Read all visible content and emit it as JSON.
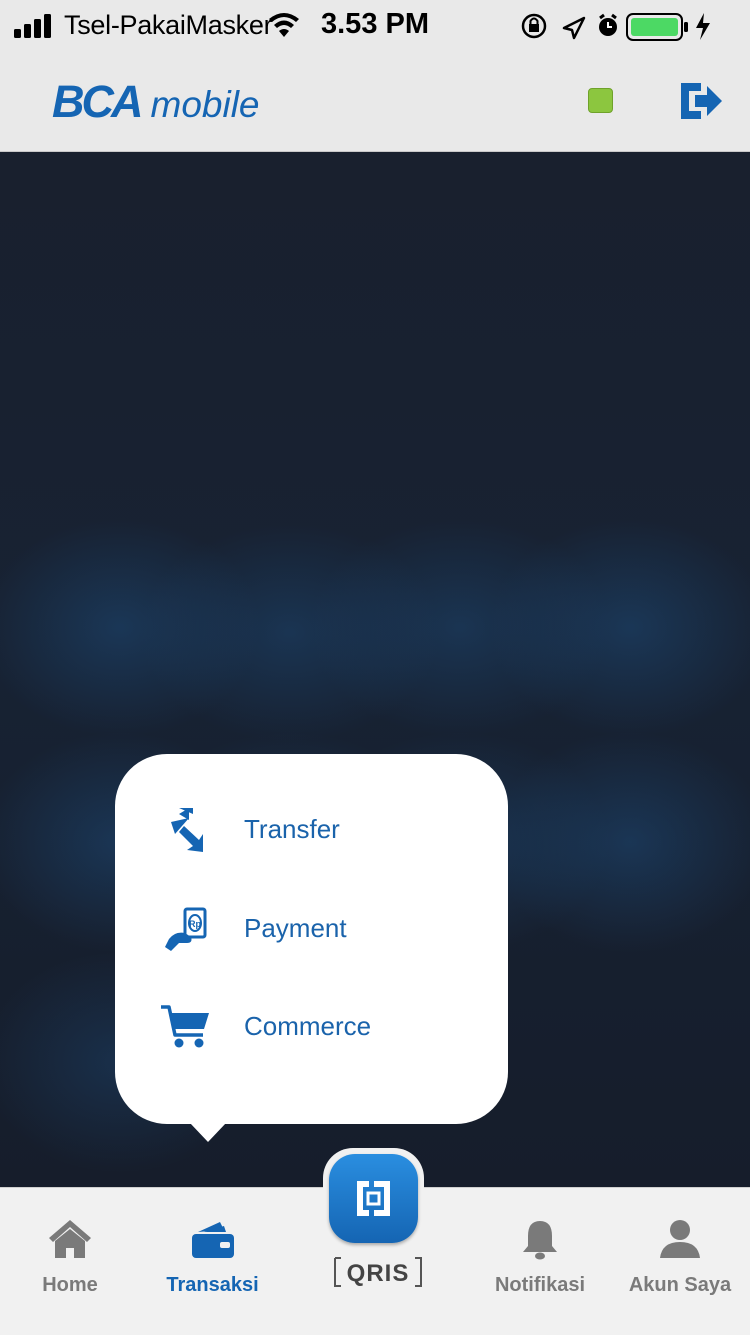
{
  "status_bar": {
    "carrier": "Tsel-PakaiMasker",
    "time": "3.53 PM",
    "icons": [
      "signal-icon",
      "wifi-icon",
      "rotation-lock-icon",
      "location-icon",
      "alarm-icon",
      "battery-icon",
      "charging-icon"
    ],
    "battery_color": "#4cd964"
  },
  "header": {
    "logo_bca": "BCA",
    "logo_mobile": "mobile",
    "status_indicator_color": "#8cc63f",
    "logout_icon": "logout-icon",
    "brand_color": "#1565b3"
  },
  "popup_menu": {
    "items": [
      {
        "label": "Transfer",
        "icon": "transfer-icon"
      },
      {
        "label": "Payment",
        "icon": "payment-icon"
      },
      {
        "label": "Commerce",
        "icon": "cart-icon"
      }
    ]
  },
  "bottom_nav": {
    "items": [
      {
        "label": "Home",
        "icon": "home-icon",
        "active": false
      },
      {
        "label": "Transaksi",
        "icon": "wallet-icon",
        "active": true
      },
      {
        "label": "QRIS",
        "icon": "qris-icon",
        "active": false
      },
      {
        "label": "Notifikasi",
        "icon": "bell-icon",
        "active": false
      },
      {
        "label": "Akun Saya",
        "icon": "user-icon",
        "active": false
      }
    ]
  }
}
